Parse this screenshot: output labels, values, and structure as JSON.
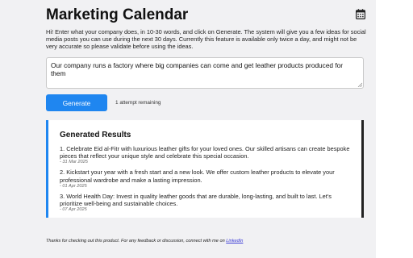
{
  "app": {
    "title": "Marketing Calendar",
    "icon": "calendar-icon"
  },
  "intro": "Hi! Enter what your company does, in 10-30 words, and click on Generate. The system will give you a few ideas for social media posts you can use during the next 30 days. Currently this feature is available only twice a day, and might not be very accurate so please validate before using the ideas.",
  "prompt": {
    "value": "Our company runs a factory where big companies can come and get leather products produced for them"
  },
  "generate": {
    "label": "Generate",
    "attempts": "1 attempt remaining"
  },
  "results": {
    "title": "Generated Results",
    "items": [
      {
        "text": "1. Celebrate Eid al-Fitr with luxurious leather gifts for your loved ones. Our skilled artisans can create bespoke pieces that reflect your unique style and celebrate this special occasion.",
        "date": "- 31 Mar 2025"
      },
      {
        "text": "2. Kickstart your year with a fresh start and a new look. We offer custom leather products to elevate your professional wardrobe and make a lasting impression.",
        "date": "- 01 Apr 2025"
      },
      {
        "text": "3. World Health Day: Invest in quality leather goods that are durable, long-lasting, and built to last. Let's prioritize well-being and sustainable choices.",
        "date": "- 07 Apr 2025"
      }
    ]
  },
  "footer": {
    "text": "Thanks for checking out this product. For any feedback or discussion, connect with me on ",
    "link": "LinkedIn"
  },
  "colors": {
    "accent": "#1f86f0",
    "background": "#f1f1f3"
  }
}
